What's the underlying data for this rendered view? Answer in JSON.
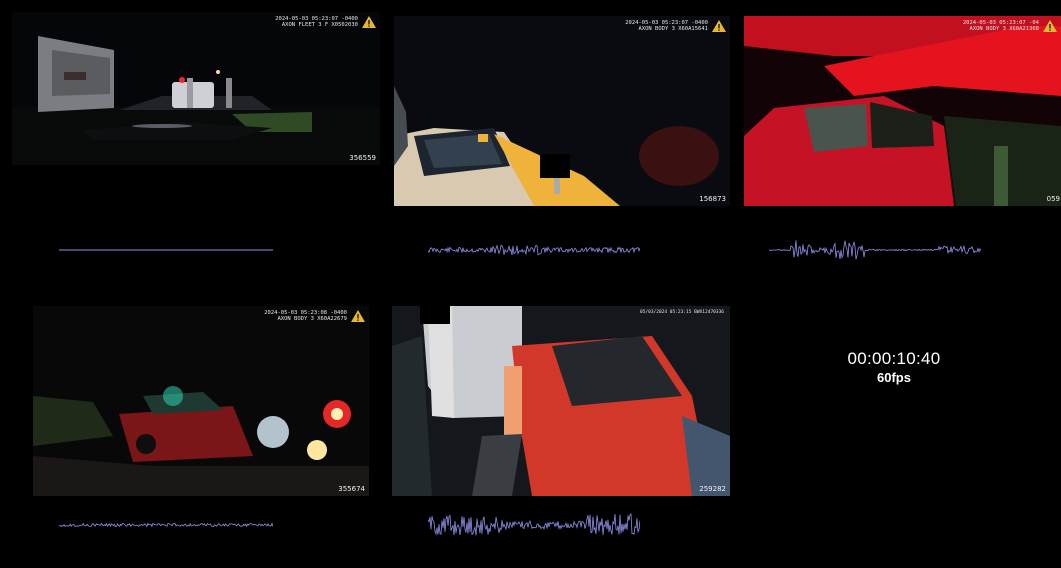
{
  "tiles": [
    {
      "id": "356559",
      "stamp": "2024-05-03 05:23:07 -0400\nAXON FLEET 3 F X0502030",
      "selected": true
    },
    {
      "id": "156873",
      "stamp": "2024-05-03 05:23:07 -0400\nAXON BODY 3 X60A15641",
      "selected": false
    },
    {
      "id": "059",
      "stamp": "2024-05-03 05:23:07 -04\nAXON BODY 3 X60A21368",
      "selected": false
    },
    {
      "id": "355674",
      "stamp": "2024-05-03 05:23:08 -0400\nAXON BODY 3 X60A22679",
      "selected": false
    },
    {
      "id": "259282",
      "stamp": "05/03/2024 05:23:15 BWX12470336",
      "selected": false
    }
  ],
  "playback": {
    "timecode": "00:00:10:40",
    "fps_label": "60fps"
  },
  "colors": {
    "selection": "#f1ec00",
    "waveform": "#8f8fe6",
    "background": "#000000"
  },
  "icons": [
    "axon-warning-icon"
  ]
}
